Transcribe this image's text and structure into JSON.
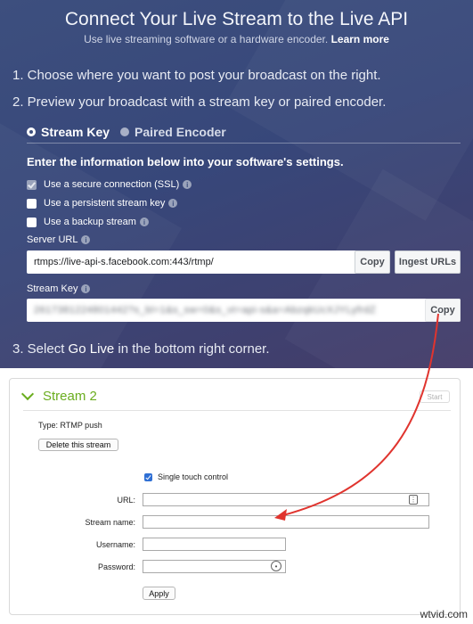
{
  "facebook": {
    "title": "Connect Your Live Stream to the Live API",
    "subtitle": "Use live streaming software or a hardware encoder.",
    "learn_more": "Learn more",
    "step1": "1. Choose where you want to post your broadcast on the right.",
    "step2": "2. Preview your broadcast with a stream key or paired encoder.",
    "tabs": [
      {
        "label": "Stream Key",
        "selected": true
      },
      {
        "label": "Paired Encoder",
        "selected": false
      }
    ],
    "instructions": "Enter the information below into your software's settings.",
    "checkboxes": [
      {
        "label": "Use a secure connection (SSL)",
        "checked": true,
        "disabled": true
      },
      {
        "label": "Use a persistent stream key",
        "checked": false
      },
      {
        "label": "Use a backup stream",
        "checked": false
      }
    ],
    "server_url": {
      "label": "Server URL",
      "value": "rtmps://live-api-s.facebook.com:443/rtmp/",
      "copy_label": "Copy",
      "ingest_label": "Ingest URLs"
    },
    "stream_key": {
      "label": "Stream Key",
      "value": "2617381224801442?s_bl=1&s_sw=0&s_vt=api-s&a=AbzqkUcXJYLyfrdZ",
      "copy_label": "Copy"
    },
    "step3_prefix": "3. Select",
    "step3_highlight": "Go Live",
    "step3_suffix": "in the bottom right corner."
  },
  "encoder": {
    "title": "Stream 2",
    "start_label": "Start",
    "type_text": "Type: RTMP push",
    "delete_label": "Delete this stream",
    "single_touch_label": "Single touch control",
    "fields": {
      "url_label": "URL:",
      "stream_name_label": "Stream name:",
      "username_label": "Username:",
      "password_label": "Password:"
    },
    "apply_label": "Apply"
  },
  "watermark": "wtvid.com",
  "icons": {
    "info": "info-icon",
    "chevron": "chevron-down-icon",
    "key": "key-icon",
    "eye": "eye-icon"
  },
  "colors": {
    "fb_background": "#3d4f7e",
    "accent_green": "#6aad1e",
    "arrow_red": "#e0342e",
    "checkbox_blue": "#2f6fd4"
  }
}
